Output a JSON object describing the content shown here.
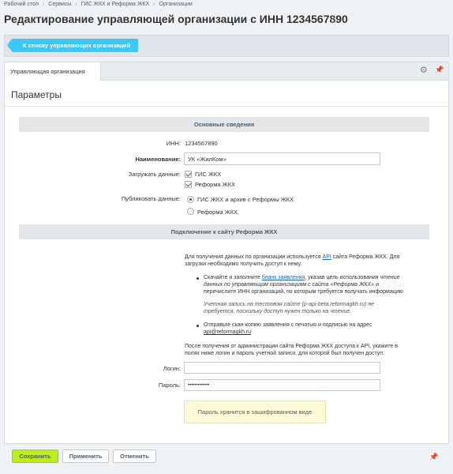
{
  "breadcrumbs": [
    "Рабочий стол",
    "Сервисы",
    "ГИС ЖКХ и Реформа ЖКХ",
    "Организации"
  ],
  "page_title": "Редактирование управляющей организации с ИНН 1234567890",
  "back_button": "К списку управляющих организаций",
  "tabs": [
    {
      "label": "Управляющая организация",
      "active": true
    }
  ],
  "section_title": "Параметры",
  "basic": {
    "heading": "Основные сведения",
    "inn_label": "ИНН:",
    "inn_value": "1234567890",
    "name_label": "Наименование:",
    "name_value": "УК «ЖилКом»",
    "load_label": "Загружать данные:",
    "load_options": [
      {
        "label": "ГИС ЖКХ",
        "checked": true
      },
      {
        "label": "Реформа ЖКХ",
        "checked": true
      }
    ],
    "publish_label": "Публиковать данные:",
    "publish_options": [
      {
        "label": "ГИС ЖКХ и архив с Реформы ЖКХ",
        "selected": true
      },
      {
        "label": "Реформа ЖКХ",
        "selected": false
      }
    ]
  },
  "connection": {
    "heading": "Подключение к сайту Реформа ЖКХ",
    "intro_1": "Для получения данных по организации используется",
    "intro_link": "API",
    "intro_2": "сайта Реформа ЖКХ. Для",
    "intro_3": "загрузки необходимо получить доступ к нему.",
    "b1_1": "Скачайте и заполните",
    "b1_link": "бланк заявления",
    "b1_2": ", указав цель использования",
    "b1_2i": "чтение",
    "b1_3i": "данных по управляющим организациям с сайта «Реформа ЖКХ»",
    "b1_3": "и",
    "b1_4": "перечислите ИНН организаций, по которым требуется получать информацию",
    "b1_note_1": "Учетная запись на тестовом сайте (p-api-beta.reformagkh.ru) не",
    "b1_note_2": "требуется, поскольку доступ нужен только на чтение.",
    "b2_1": "Отправьте скан-копию заявления с печатью и подписью на адрес",
    "b2_link": "api@reformagkh.ru",
    "after_1": "После получения от администрации сайта Реформа ЖКХ доступа к API, укажите в",
    "after_2": "полях ниже логин и пароль учетной записи, для которой был получен доступ.",
    "login_label": "Логин:",
    "login_value": "",
    "password_label": "Пароль:",
    "password_value": "•••••••••••••",
    "note": "Пароль хранится в зашифрованном виде"
  },
  "footer": {
    "save": "Сохранить",
    "apply": "Применить",
    "cancel": "Отменить"
  },
  "colors": {
    "accent": "#3bc8f5",
    "save_green": "#bbed21",
    "link": "#2067b0",
    "note_bg": "#fef9d7"
  },
  "icons": [
    "star-icon",
    "gear-icon",
    "pin-icon"
  ]
}
